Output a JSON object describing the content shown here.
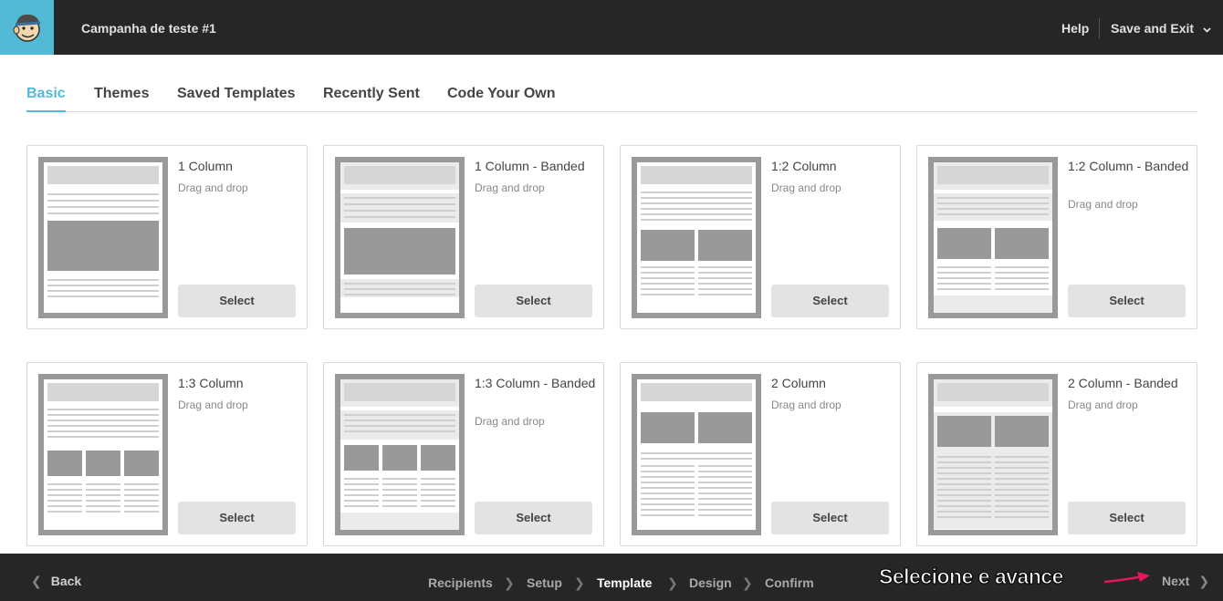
{
  "header": {
    "campaign_title": "Campanha de teste #1",
    "help_label": "Help",
    "save_exit_label": "Save and Exit",
    "logo_icon": "mailchimp-monkey-icon",
    "brand_color": "#52bad5"
  },
  "tabs": [
    {
      "label": "Basic",
      "active": true
    },
    {
      "label": "Themes",
      "active": false
    },
    {
      "label": "Saved Templates",
      "active": false
    },
    {
      "label": "Recently Sent",
      "active": false
    },
    {
      "label": "Code Your Own",
      "active": false
    }
  ],
  "templates": [
    {
      "title": "1 Column",
      "subtitle": "Drag and drop",
      "button": "Select"
    },
    {
      "title": "1 Column - Banded",
      "subtitle": "Drag and drop",
      "button": "Select"
    },
    {
      "title": "1:2 Column",
      "subtitle": "Drag and drop",
      "button": "Select"
    },
    {
      "title": "1:2 Column - Banded",
      "subtitle": "Drag and drop",
      "button": "Select"
    },
    {
      "title": "1:3 Column",
      "subtitle": "Drag and drop",
      "button": "Select"
    },
    {
      "title": "1:3 Column - Banded",
      "subtitle": "Drag and drop",
      "button": "Select"
    },
    {
      "title": "2 Column",
      "subtitle": "Drag and drop",
      "button": "Select"
    },
    {
      "title": "2 Column - Banded",
      "subtitle": "Drag and drop",
      "button": "Select"
    }
  ],
  "footer": {
    "back_label": "Back",
    "steps": [
      "Recipients",
      "Setup",
      "Template",
      "Design",
      "Confirm"
    ],
    "current_step": "Template",
    "annotation": "Selecione e avance",
    "next_label": "Next",
    "arrow_color": "#e8175d"
  }
}
